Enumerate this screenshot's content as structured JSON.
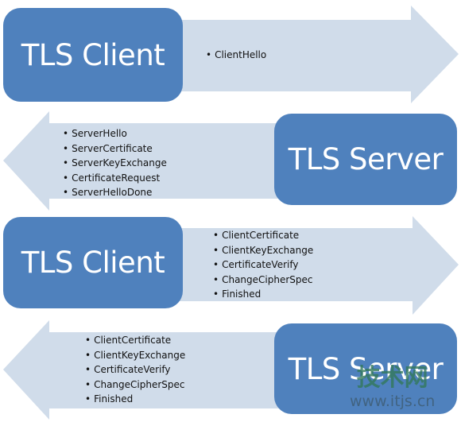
{
  "colors": {
    "box": "#4f81bd",
    "arrow": "#d0dcea",
    "text": "#111111"
  },
  "rows": [
    {
      "direction": "right",
      "entity": "TLS Client",
      "messages": [
        "ClientHello"
      ]
    },
    {
      "direction": "left",
      "entity": "TLS Server",
      "messages": [
        "ServerHello",
        "ServerCertificate",
        "ServerKeyExchange",
        "CertificateRequest",
        "ServerHelloDone"
      ]
    },
    {
      "direction": "right",
      "entity": "TLS Client",
      "messages": [
        "ClientCertificate",
        "ClientKeyExchange",
        "CertificateVerify",
        "ChangeCipherSpec",
        "Finished"
      ]
    },
    {
      "direction": "left",
      "entity": "TLS Server",
      "messages": [
        "ClientCertificate",
        "ClientKeyExchange",
        "CertificateVerify",
        "ChangeCipherSpec",
        "Finished"
      ]
    }
  ],
  "watermark": {
    "name": "技术网",
    "url": "www.itjs.cn"
  }
}
